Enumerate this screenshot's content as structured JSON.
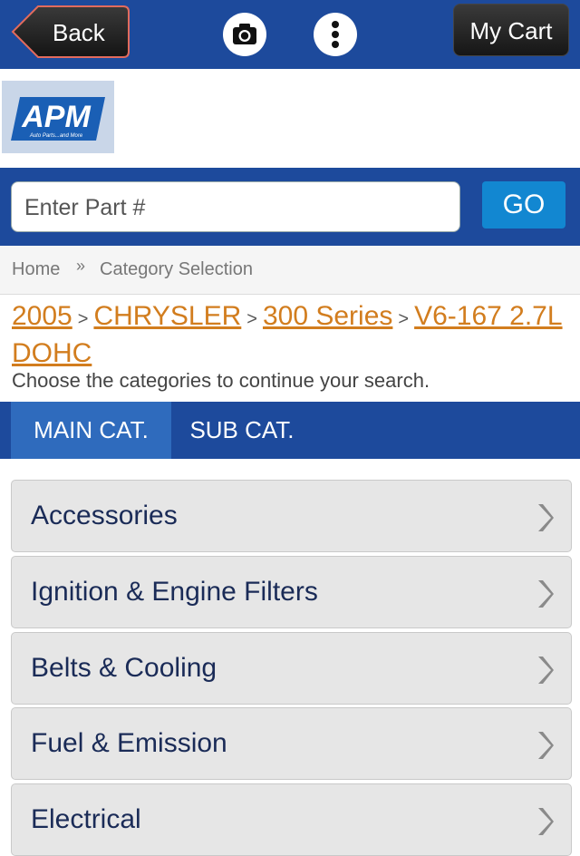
{
  "topbar": {
    "back_label": "Back",
    "cart_label": "My Cart",
    "camera_icon": "camera-icon",
    "menu_icon": "more-vertical-icon"
  },
  "logo": {
    "brand": "APM",
    "tagline": "Auto Parts...and More"
  },
  "search": {
    "placeholder": "Enter Part #",
    "go_label": "GO"
  },
  "breadcrumb": {
    "home": "Home",
    "separator": "»",
    "current": "Category Selection"
  },
  "vehicle": {
    "year": "2005",
    "make": "CHRYSLER",
    "model": "300 Series",
    "engine": "V6-167 2.7L DOHC",
    "separator": ">"
  },
  "instruction": "Choose the categories to continue your search.",
  "tabs": {
    "main": "MAIN CAT.",
    "sub": "SUB CAT."
  },
  "categories": [
    {
      "label": "Accessories"
    },
    {
      "label": "Ignition & Engine Filters"
    },
    {
      "label": "Belts & Cooling"
    },
    {
      "label": "Fuel & Emission"
    },
    {
      "label": "Electrical"
    }
  ],
  "colors": {
    "brand_blue": "#1d4a9c",
    "accent_orange": "#d27d1e",
    "go_blue": "#1287d1"
  }
}
